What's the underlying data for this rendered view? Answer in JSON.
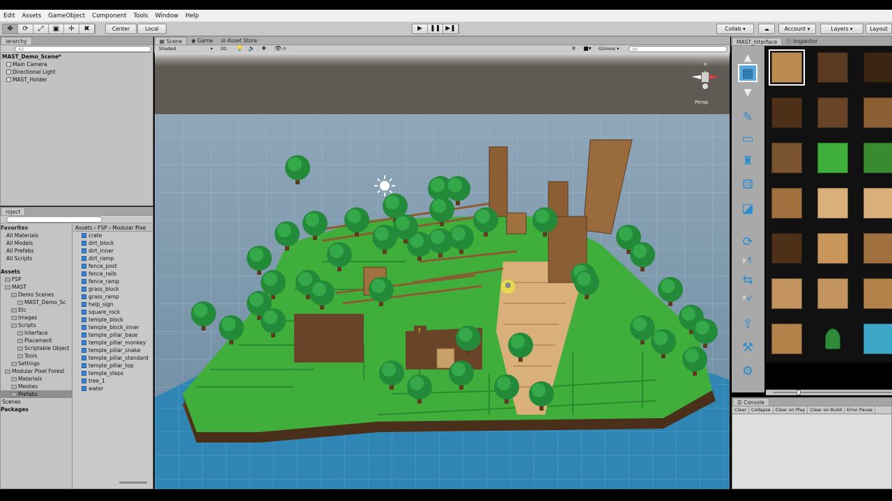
{
  "menu": [
    "Edit",
    "Assets",
    "GameObject",
    "Component",
    "Tools",
    "Window",
    "Help"
  ],
  "toolbar": {
    "tools": [
      "✥",
      "⟳",
      "⤢",
      "▣",
      "✢",
      "✖"
    ],
    "pivot": "Center",
    "space": "Local",
    "play_buttons": [
      "▶",
      "❚❚",
      "▶❚"
    ],
    "collab": "Collab ▾",
    "cloud": "☁",
    "account": "Account ▾",
    "layers": "Layers ▾",
    "layout": "Layout"
  },
  "hierarchy": {
    "tab": "ierarchy",
    "search_placeholder": "All",
    "scene_name": "MAST_Demo_Scene*",
    "items": [
      "Main Camera",
      "Directional Light",
      "MAST_Holder"
    ]
  },
  "project": {
    "tab": "roject",
    "favorites_label": "Favorites",
    "favorites": [
      "All Materials",
      "All Models",
      "All Prefabs",
      "All Scripts"
    ],
    "assets_label": "Assets",
    "tree": [
      {
        "label": "FSP",
        "depth": 0
      },
      {
        "label": "MAST",
        "depth": 0
      },
      {
        "label": "Demo Scenes",
        "depth": 1
      },
      {
        "label": "MAST_Demo_Sc",
        "depth": 2
      },
      {
        "label": "Etc",
        "depth": 1
      },
      {
        "label": "Images",
        "depth": 1
      },
      {
        "label": "Scripts",
        "depth": 1
      },
      {
        "label": "Interface",
        "depth": 2
      },
      {
        "label": "Placement",
        "depth": 2
      },
      {
        "label": "Scriptable Object",
        "depth": 2
      },
      {
        "label": "Tools",
        "depth": 2
      },
      {
        "label": "Settings",
        "depth": 1
      },
      {
        "label": "Modular Pixel Forest",
        "depth": 0
      },
      {
        "label": "Materials",
        "depth": 1
      },
      {
        "label": "Meshes",
        "depth": 1
      },
      {
        "label": "Prefabs",
        "depth": 1
      }
    ],
    "scenes_label": "Scenes",
    "packages_label": "Packages",
    "breadcrumb": "Assets › FSP › Modular Pixe",
    "files": [
      "crate",
      "dirt_block",
      "dirt_inner",
      "dirt_ramp",
      "fence_post",
      "fence_rails",
      "fence_ramp",
      "grass_block",
      "grass_ramp",
      "help_sign",
      "square_rock",
      "temple_block",
      "temple_block_inner",
      "temple_pillar_base",
      "temple_pillar_monkey",
      "temple_pillar_snake",
      "temple_pillar_standard",
      "temple_pillar_top",
      "temple_steps",
      "tree_1",
      "water"
    ]
  },
  "scene_view": {
    "tabs": [
      "Scene",
      "Game",
      "Asset Store"
    ],
    "shading": "Shaded",
    "mode_2d": "2D",
    "fx_count": "0",
    "gizmos": "Gizmos ▾",
    "search_placeholder": "All",
    "persp_label": "Persp",
    "axis_labels": {
      "y": "y",
      "x": "x"
    }
  },
  "right_panel": {
    "tabs": [
      "MAST_Interface",
      "Inspector"
    ]
  },
  "console": {
    "tab": "Console",
    "buttons": [
      "Clear",
      "Collapse",
      "Clear on Play",
      "Clear on Build",
      "Error Pause"
    ]
  },
  "colors": {
    "grass": "#3fae3a",
    "grass_dark": "#2b8a2e",
    "dirt": "#5b3a22",
    "temple": "#d9b07a",
    "water": "#2f86b5",
    "sky": "#8f98a0",
    "accent": "#2a8cd0"
  }
}
